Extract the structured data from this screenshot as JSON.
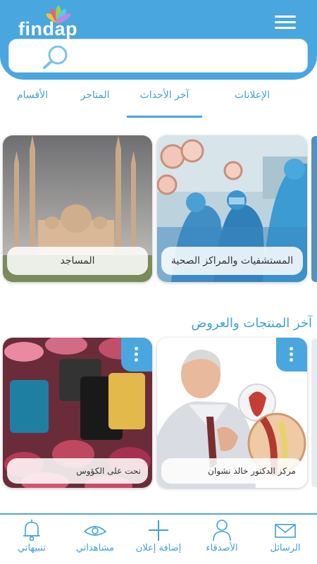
{
  "app": {
    "logo_text": "findap",
    "brand_color": "#4aa6df",
    "text_color": "#3f9fd9"
  },
  "header": {
    "menu_icon": "hamburger-menu-icon",
    "search": {
      "icon": "search-icon",
      "placeholder": "",
      "value": ""
    }
  },
  "tabs": [
    {
      "label": "الإعلانات",
      "active": false
    },
    {
      "label": "آخر الأحداث",
      "active": true
    },
    {
      "label": "المتاجر",
      "active": false
    },
    {
      "label": "الأقسام",
      "active": false
    }
  ],
  "categories": [
    {
      "label": "المستشفيات والمراكز الصحية",
      "image": "surgery-team-photo"
    },
    {
      "label": "المساجد",
      "image": "mosque-photo"
    }
  ],
  "latest_section": {
    "title": "آخر المنتجات والعروض",
    "items": [
      {
        "label": "مركز الدكتور خالد نشوان",
        "image": "heart-patient-photo",
        "menu_icon": "more-vertical-icon"
      },
      {
        "label": "نحت على الكؤوس",
        "image": "engraved-mugs-photo",
        "menu_icon": "more-vertical-icon"
      }
    ]
  },
  "bottom_nav": [
    {
      "label": "الرسائل",
      "icon": "envelope-icon"
    },
    {
      "label": "الأصدقاء",
      "icon": "person-icon"
    },
    {
      "label": "إضافة إعلان",
      "icon": "plus-icon"
    },
    {
      "label": "مشاهداتي",
      "icon": "eye-icon"
    },
    {
      "label": "تنبيهاتي",
      "icon": "bell-icon"
    }
  ]
}
